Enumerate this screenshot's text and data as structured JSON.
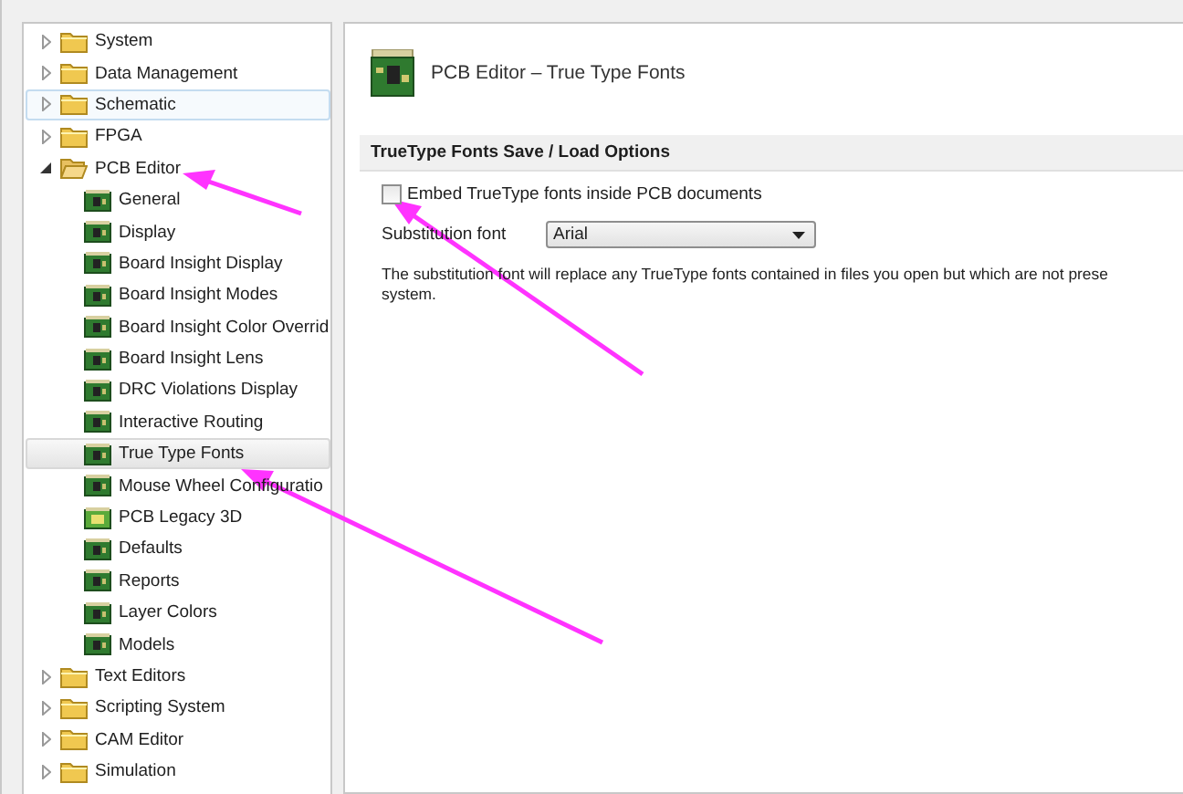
{
  "sidebar": {
    "items": [
      {
        "label": "System",
        "expanded": false,
        "selected": false,
        "hovered": false
      },
      {
        "label": "Data Management",
        "expanded": false,
        "selected": false,
        "hovered": false
      },
      {
        "label": "Schematic",
        "expanded": false,
        "selected": false,
        "hovered": true
      },
      {
        "label": "FPGA",
        "expanded": false,
        "selected": false,
        "hovered": false
      },
      {
        "label": "PCB Editor",
        "expanded": true,
        "selected": false,
        "hovered": false,
        "children": [
          {
            "label": "General",
            "kind": "board",
            "selected": false
          },
          {
            "label": "Display",
            "kind": "board",
            "selected": false
          },
          {
            "label": "Board Insight Display",
            "kind": "board",
            "selected": false
          },
          {
            "label": "Board Insight Modes",
            "kind": "board",
            "selected": false
          },
          {
            "label": "Board Insight Color Overrid",
            "kind": "board",
            "selected": false
          },
          {
            "label": "Board Insight Lens",
            "kind": "board",
            "selected": false
          },
          {
            "label": "DRC Violations Display",
            "kind": "board",
            "selected": false
          },
          {
            "label": "Interactive Routing",
            "kind": "board",
            "selected": false
          },
          {
            "label": "True Type Fonts",
            "kind": "board",
            "selected": true
          },
          {
            "label": "Mouse Wheel Configuratio",
            "kind": "board",
            "selected": false
          },
          {
            "label": "PCB Legacy 3D",
            "kind": "board-3d",
            "selected": false
          },
          {
            "label": "Defaults",
            "kind": "board",
            "selected": false
          },
          {
            "label": "Reports",
            "kind": "board",
            "selected": false
          },
          {
            "label": "Layer Colors",
            "kind": "board",
            "selected": false
          },
          {
            "label": "Models",
            "kind": "board",
            "selected": false
          }
        ]
      },
      {
        "label": "Text Editors",
        "expanded": false,
        "selected": false,
        "hovered": false
      },
      {
        "label": "Scripting System",
        "expanded": false,
        "selected": false,
        "hovered": false
      },
      {
        "label": "CAM Editor",
        "expanded": false,
        "selected": false,
        "hovered": false
      },
      {
        "label": "Simulation",
        "expanded": false,
        "selected": false,
        "hovered": false
      }
    ]
  },
  "page": {
    "title": "PCB Editor – True Type Fonts",
    "section": "TrueType Fonts Save / Load Options",
    "embed_checkbox": {
      "label": "Embed TrueType fonts inside PCB documents",
      "checked": false
    },
    "substitution": {
      "label": "Substitution font",
      "value": "Arial"
    },
    "note": [
      "The substitution font will replace any TrueType fonts contained in files you open but which are not prese",
      "system."
    ]
  }
}
